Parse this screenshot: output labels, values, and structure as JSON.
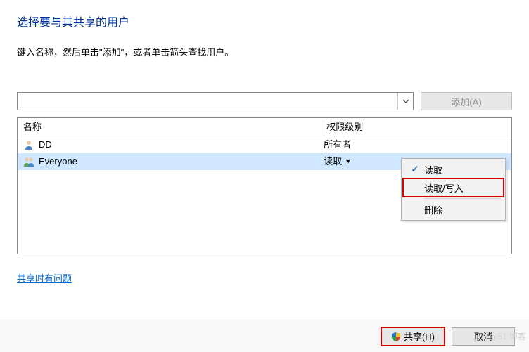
{
  "title": "选择要与其共享的用户",
  "hint": "键入名称，然后单击\"添加\"，或者单击箭头查找用户。",
  "input": {
    "value": "",
    "placeholder": ""
  },
  "add_label": "添加(A)",
  "table": {
    "headers": {
      "name": "名称",
      "perm": "权限级别"
    },
    "rows": [
      {
        "name": "DD",
        "perm": "所有者",
        "icon": "user",
        "dropdown": false,
        "selected": false
      },
      {
        "name": "Everyone",
        "perm": "读取",
        "icon": "group",
        "dropdown": true,
        "selected": true
      }
    ]
  },
  "menu": {
    "items": [
      {
        "label": "读取",
        "checked": true,
        "highlight": false
      },
      {
        "label": "读取/写入",
        "checked": false,
        "highlight": true
      }
    ],
    "secondary": [
      {
        "label": "删除",
        "checked": false
      }
    ]
  },
  "help_link": "共享时有问题",
  "footer": {
    "share": "共享(H)",
    "cancel": "取消"
  },
  "watermark": "@51     博客"
}
